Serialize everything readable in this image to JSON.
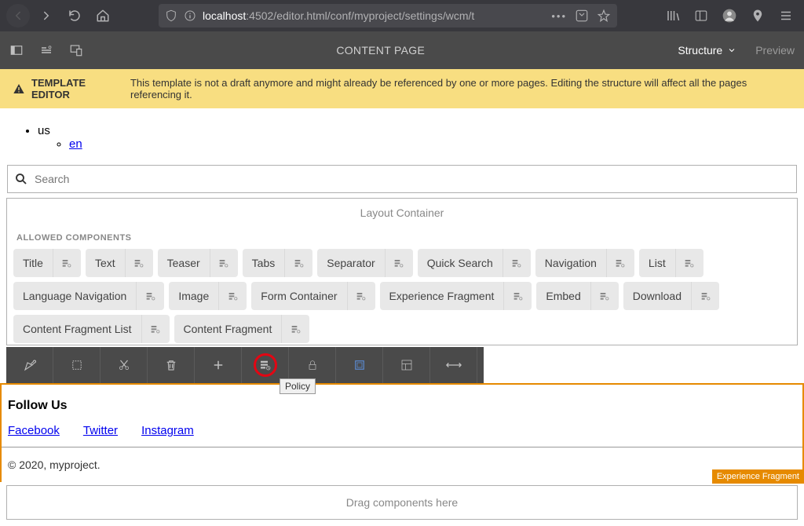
{
  "browser": {
    "url_host": "localhost",
    "url_path": ":4502/editor.html/conf/myproject/settings/wcm/t"
  },
  "toolbar": {
    "title": "CONTENT PAGE",
    "mode": "Structure",
    "preview": "Preview"
  },
  "warning": {
    "label": "TEMPLATE EDITOR",
    "text": "This template is not a draft anymore and might already be referenced by one or more pages. Editing the structure will affect all the pages referencing it."
  },
  "langs": {
    "root": "us",
    "child": "en"
  },
  "search": {
    "placeholder": "Search"
  },
  "layoutContainer": {
    "title": "Layout Container",
    "allowedLabel": "ALLOWED COMPONENTS",
    "components": [
      "Title",
      "Text",
      "Teaser",
      "Tabs",
      "Separator",
      "Quick Search",
      "Navigation",
      "List",
      "Language Navigation",
      "Image",
      "Form Container",
      "Experience Fragment",
      "Embed",
      "Download",
      "Content Fragment List",
      "Content Fragment"
    ]
  },
  "actionBar": {
    "tooltip": "Policy"
  },
  "footer": {
    "heading": "Follow Us",
    "links": [
      "Facebook",
      "Twitter",
      "Instagram"
    ],
    "copyright": "© 2020, myproject.",
    "badge": "Experience Fragment"
  },
  "dropzone": {
    "text": "Drag components here"
  }
}
